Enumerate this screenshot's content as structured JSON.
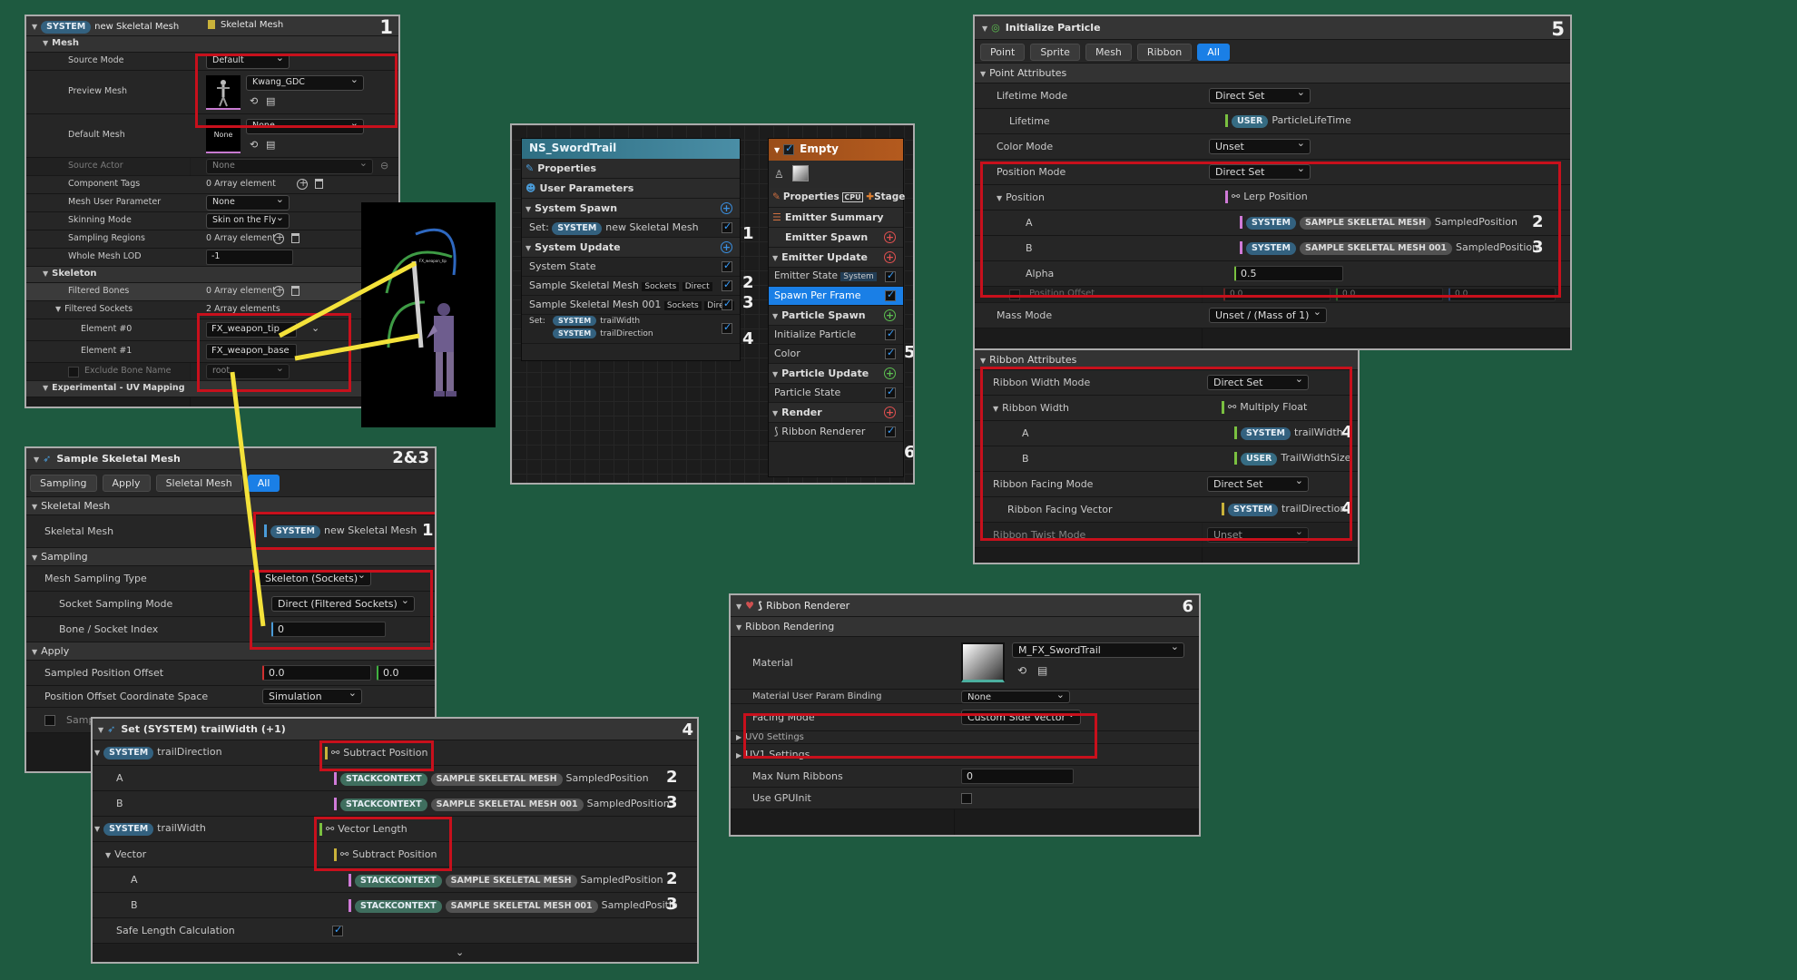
{
  "p1": {
    "sys_pill": "SYSTEM",
    "title": "new Skeletal Mesh",
    "type": "Skeletal Mesh",
    "num": "1",
    "mesh_cat": "Mesh",
    "source_mode_lbl": "Source Mode",
    "source_mode_val": "Default",
    "preview_mesh_lbl": "Preview Mesh",
    "preview_mesh_val": "Kwang_GDC",
    "default_mesh_lbl": "Default Mesh",
    "default_mesh_val": "None",
    "default_thumb": "None",
    "source_actor_lbl": "Source Actor",
    "source_actor_val": "None",
    "component_tags_lbl": "Component Tags",
    "component_tags_val": "0 Array element",
    "mesh_user_param_lbl": "Mesh User Parameter",
    "mesh_user_param_val": "None",
    "skinning_mode_lbl": "Skinning Mode",
    "skinning_mode_val": "Skin on the Fly",
    "sampling_regions_lbl": "Sampling Regions",
    "sampling_regions_val": "0 Array element",
    "whole_mesh_lod_lbl": "Whole Mesh LOD",
    "whole_mesh_lod_val": "-1",
    "skeleton_cat": "Skeleton",
    "filtered_bones_lbl": "Filtered Bones",
    "filtered_bones_val": "0 Array element",
    "filtered_sockets_lbl": "Filtered Sockets",
    "filtered_sockets_val": "2 Array elements",
    "el0_lbl": "Element #0",
    "el0_val": "FX_weapon_tip",
    "el1_lbl": "Element #1",
    "el1_val": "FX_weapon_base",
    "exclude_lbl": "Exclude Bone Name",
    "exclude_val": "root",
    "exp_cat": "Experimental - UV Mapping",
    "viewport_label": "FX_weapon_tip"
  },
  "p2": {
    "title": "Sample Skeletal Mesh",
    "num": "2&3",
    "tabs": [
      "Sampling",
      "Apply",
      "Sleletal Mesh",
      "All"
    ],
    "cat_skel": "Skeletal Mesh",
    "skel_lbl": "Skeletal Mesh",
    "skel_pill": "SYSTEM",
    "skel_val": "new Skeletal Mesh",
    "skel_num": "1",
    "cat_sampling": "Sampling",
    "mst_lbl": "Mesh Sampling Type",
    "mst_val": "Skeleton (Sockets)",
    "ssm_lbl": "Socket Sampling Mode",
    "ssm_val": "Direct (Filtered Sockets)",
    "bsi_lbl": "Bone / Socket Index",
    "bsi_val": "0",
    "cat_apply": "Apply",
    "spo_lbl": "Sampled Position Offset",
    "spo_x": "0.0",
    "spo_y": "0.0",
    "pocs_lbl": "Position Offset Coordinate Space",
    "pocs_val": "Simulation",
    "samp_lbl": "Samp"
  },
  "p3": {
    "title": "NS_SwordTrail",
    "properties": "Properties",
    "user_params": "User Parameters",
    "system_spawn": "System Spawn",
    "set_lbl": "Set:",
    "set_pill": "SYSTEM",
    "set_val": "new Skeletal Mesh",
    "system_update": "System Update",
    "system_state": "System State",
    "ssm": "Sample Skeletal Mesh",
    "ssm001": "Sample Skeletal Mesh 001",
    "sockets": "Sockets",
    "direct": "Direct",
    "set2_lbl": "Set:",
    "set2_a_pill": "SYSTEM",
    "set2_a": "trailWidth",
    "set2_b_pill": "SYSTEM",
    "set2_b": "trailDirection",
    "n1": "1",
    "n2": "2",
    "n3": "3",
    "n4": "4"
  },
  "p4": {
    "title": "Empty",
    "properties": "Properties",
    "cpu": "CPU",
    "stage": "Stage",
    "emitter_summary": "Emitter Summary",
    "emitter_spawn": "Emitter Spawn",
    "emitter_update": "Emitter Update",
    "emitter_state": "Emitter State",
    "emitter_state_tag": "System",
    "spawn_per_frame": "Spawn Per Frame",
    "particle_spawn": "Particle Spawn",
    "initialize_particle": "Initialize Particle",
    "color": "Color",
    "particle_update": "Particle Update",
    "particle_state": "Particle State",
    "render": "Render",
    "ribbon_renderer": "Ribbon Renderer",
    "n5": "5",
    "n6": "6"
  },
  "p5": {
    "title": "Initialize Particle",
    "num": "5",
    "tabs": [
      "Point",
      "Sprite",
      "Mesh",
      "Ribbon",
      "All"
    ],
    "point_attr": "Point Attributes",
    "lifetime_mode_lbl": "Lifetime Mode",
    "lifetime_mode_val": "Direct Set",
    "lifetime_lbl": "Lifetime",
    "lifetime_pill": "USER",
    "lifetime_val": "ParticleLifeTime",
    "color_mode_lbl": "Color Mode",
    "color_mode_val": "Unset",
    "position_mode_lbl": "Position Mode",
    "position_mode_val": "Direct Set",
    "position_lbl": "Position",
    "position_val": "Lerp Position",
    "a_lbl": "A",
    "a_pill1": "SYSTEM",
    "a_pill2": "SAMPLE SKELETAL MESH",
    "a_val": "SampledPosition",
    "a_num": "2",
    "b_lbl": "B",
    "b_pill1": "SYSTEM",
    "b_pill2": "SAMPLE SKELETAL MESH 001",
    "b_val": "SampledPosition",
    "b_num": "3",
    "alpha_lbl": "Alpha",
    "alpha_val": "0.5",
    "pos_offset_lbl": "Position Offset",
    "po_x": "0.0",
    "po_y": "0.0",
    "po_z": "0.0",
    "mass_mode_lbl": "Mass Mode",
    "mass_mode_val": "Unset / (Mass of 1)",
    "ribbon_attr": "Ribbon Attributes",
    "rwm_lbl": "Ribbon Width Mode",
    "rwm_val": "Direct Set",
    "rw_lbl": "Ribbon Width",
    "rw_val": "Multiply Float",
    "rwa_lbl": "A",
    "rwa_pill": "SYSTEM",
    "rwa_val": "trailWidth",
    "rwa_num": "4",
    "rwb_lbl": "B",
    "rwb_pill": "USER",
    "rwb_val": "TrailWidthSize",
    "rfm_lbl": "Ribbon Facing Mode",
    "rfm_val": "Direct Set",
    "rfv_lbl": "Ribbon Facing Vector",
    "rfv_pill": "SYSTEM",
    "rfv_val": "trailDirection",
    "rfv_num": "4",
    "rtm_lbl": "Ribbon Twist Mode",
    "rtm_val": "Unset"
  },
  "p6": {
    "title": "Set (SYSTEM) trailWidth (+1)",
    "num": "4",
    "td_pill": "SYSTEM",
    "td_lbl": "trailDirection",
    "td_val": "Subtract Position",
    "a_lbl": "A",
    "b_lbl": "B",
    "stk": "STACKCONTEXT",
    "ssm": "SAMPLE SKELETAL MESH",
    "ssm001": "SAMPLE SKELETAL MESH 001",
    "sp": "SampledPosition",
    "spb": "SampledPositio",
    "n2": "2",
    "n3": "3",
    "tw_pill": "SYSTEM",
    "tw_lbl": "trailWidth",
    "tw_val": "Vector Length",
    "vec_lbl": "Vector",
    "vec_val": "Subtract Position",
    "slc_lbl": "Safe Length Calculation"
  },
  "p7": {
    "title": "Ribbon Renderer",
    "num": "6",
    "cat": "Ribbon Rendering",
    "material_lbl": "Material",
    "material_val": "M_FX_SwordTrail",
    "mupb_lbl": "Material User Param Binding",
    "mupb_val": "None",
    "facing_lbl": "Facing Mode",
    "facing_val": "Custom Side Vector",
    "uv0_lbl": "UV0 Settings",
    "uv1_lbl": "UV1 Settings",
    "mnr_lbl": "Max Num Ribbons",
    "mnr_val": "0",
    "gpu_lbl": "Use GPUInit"
  }
}
